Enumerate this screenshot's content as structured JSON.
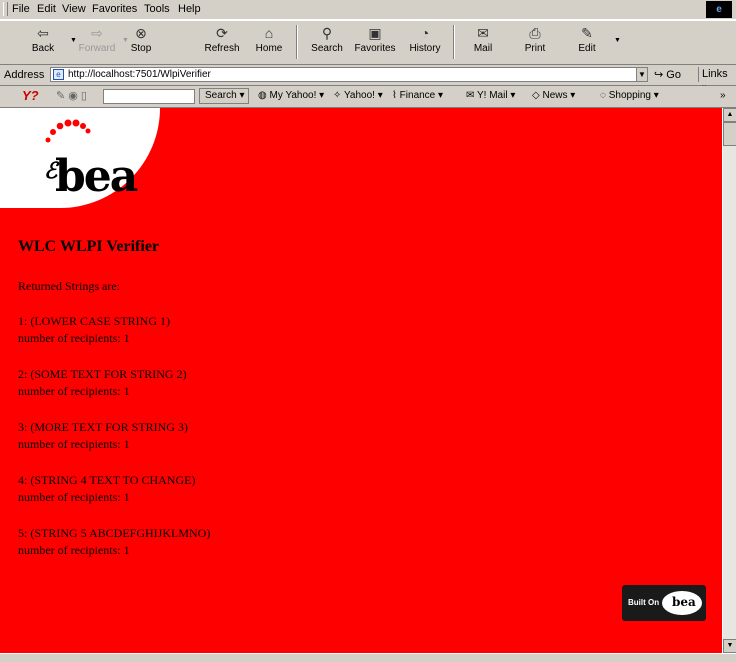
{
  "menu": {
    "file": "File",
    "edit": "Edit",
    "view": "View",
    "favorites": "Favorites",
    "tools": "Tools",
    "help": "Help"
  },
  "toolbar": {
    "back": "Back",
    "forward": "Forward",
    "stop": "Stop",
    "refresh": "Refresh",
    "home": "Home",
    "search": "Search",
    "favorites": "Favorites",
    "history": "History",
    "mail": "Mail",
    "print": "Print",
    "edit": "Edit"
  },
  "address": {
    "label": "Address",
    "url": "http://localhost:7501/WlpiVerifier",
    "go": "Go",
    "links": "Links"
  },
  "yahoo": {
    "search_btn": "Search",
    "links": [
      "My Yahoo!",
      "Yahoo!",
      "Finance",
      "Y! Mail",
      "News",
      "Shopping"
    ]
  },
  "page": {
    "logo_text": "bea",
    "title": "WLC WLPI Verifier",
    "returned_label": "Returned Strings are:",
    "records": [
      {
        "line1": "1: (LOWER CASE STRING 1)",
        "line2": "number of recipients: 1"
      },
      {
        "line1": "2: (SOME TEXT FOR STRING 2)",
        "line2": "number of recipients: 1"
      },
      {
        "line1": "3: (MORE TEXT FOR STRING 3)",
        "line2": "number of recipients: 1"
      },
      {
        "line1": "4: (STRING 4 TEXT TO CHANGE)",
        "line2": "number of recipients: 1"
      },
      {
        "line1": "5: (STRING 5 ABCDEFGHIJKLMNO)",
        "line2": "number of recipients: 1"
      }
    ],
    "built_on": "Built On",
    "built_on_logo": "bea"
  },
  "colors": {
    "page_background": "#ff0000",
    "chrome": "#d4d0c8"
  }
}
